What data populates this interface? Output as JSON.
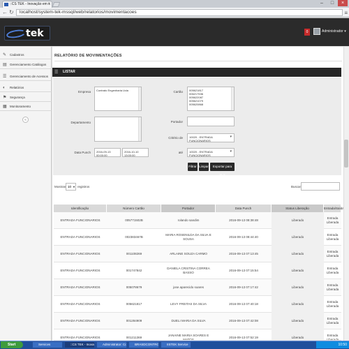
{
  "browser": {
    "tab_title": "::CS TEK - Inovação em s",
    "url": "localhost/system-tek-mssql/web/relatorios/movimentacoes"
  },
  "header": {
    "logo_text": "tek",
    "notification_count": "0",
    "user_name": "Administrador ▾"
  },
  "sidebar": {
    "items": [
      {
        "label": "Cadastros",
        "icon": "✎"
      },
      {
        "label": "Gerenciamento Catálogos",
        "icon": "▤"
      },
      {
        "label": "Gerenciamento de Acessos",
        "icon": "☰"
      },
      {
        "label": "Relatórios",
        "icon": "◐"
      },
      {
        "label": "Segurança",
        "icon": "⚑"
      },
      {
        "label": "Monitoramento",
        "icon": "▦"
      }
    ],
    "collapse_icon": "«"
  },
  "page": {
    "title": "RELATÓRIO DE MOVIMENTAÇÕES",
    "panel_title": "LISTAR"
  },
  "filters": {
    "empresa_label": "Empresa",
    "empresa_value": "Contrato Engenharia Ltda",
    "cartao_label": "Cartão",
    "cartao_values": [
      "005621817",
      "006217536",
      "005622087",
      "005621079",
      "005620868"
    ],
    "departamento_label": "Departamento",
    "portador_label": "Portador",
    "data_label": "Data Punch",
    "data_from": "2016-09-13 00:00:00",
    "data_to": "2016-10-10 13:00:00",
    "criterio_label": "Critério de",
    "criterio_value": "10020 - ENTRADA FUNCIONARIOS",
    "ate_label": "até",
    "ate_value": "10020 - ENTRADA FUNCIONARIOS",
    "btn_filtrar": "Filtrar",
    "btn_limpar": "Limpar",
    "btn_exportar": "Exportar para XLS"
  },
  "listing": {
    "show_label": "Mostrando",
    "show_value": "10",
    "show_after": "registros",
    "search_label": "Buscar:"
  },
  "table": {
    "headers": [
      "Identificação",
      "Número Cartão",
      "Portador",
      "Data Punch",
      "Status Liberação",
      "Entrada/Saída"
    ],
    "rows": [
      {
        "id": "ENTRADA FUNCIONARIOS",
        "card": "005771502B",
        "holder": "rolando sandim",
        "date": "2016-09-13 08:38:48",
        "status": "Liberado",
        "dir": "Entrada Liberada"
      },
      {
        "id": "ENTRADA FUNCIONARIOS",
        "card": "002383467B",
        "holder": "MARIA ROSENILDA DA SILVA E SOUSA",
        "date": "2016-09-13 08:44:40",
        "status": "Liberado",
        "dir": "Entrada Liberada"
      },
      {
        "id": "ENTRADA FUNCIONARIOS",
        "card": "001108269",
        "holder": "ARLAINE SOUZA CARMO",
        "date": "2016-09-13 07:13:45",
        "status": "Liberado",
        "dir": "Entrada Liberada"
      },
      {
        "id": "ENTRADA FUNCIONARIOS",
        "card": "001747842",
        "holder": "DANIELA CRISTINA CORREA BASSO",
        "date": "2016-09-13 07:15:54",
        "status": "Liberado",
        "dir": "Entrada Liberada"
      },
      {
        "id": "ENTRADA FUNCIONARIOS",
        "card": "005078679",
        "holder": "jose aparecido soares",
        "date": "2016-09-13 07:17:42",
        "status": "Liberado",
        "dir": "Entrada Liberada"
      },
      {
        "id": "ENTRADA FUNCIONARIOS",
        "card": "005621817",
        "holder": "LEVY FREITAS DA SILVA",
        "date": "2016-09-13 07:40:18",
        "status": "Liberado",
        "dir": "Entrada Liberada"
      },
      {
        "id": "ENTRADA FUNCIONARIOS",
        "card": "001284909",
        "holder": "DUELI MARIA DA SILVA",
        "date": "2016-09-13 07:42:08",
        "status": "Liberado",
        "dir": "Entrada Liberada"
      },
      {
        "id": "ENTRADA FUNCIONARIOS",
        "card": "001211369",
        "holder": "JANAINE MARIA SOARES E MATOS",
        "date": "2016-09-13 07:52:19",
        "status": "Liberado",
        "dir": "Entrada Liberada"
      }
    ]
  },
  "taskbar": {
    "start": "Start",
    "tasks": [
      "Services",
      "::CS TEK - Inovação em s...",
      "Administrator: Command...",
      "BRASDCONTROL Acesso...",
      "IISTEK Service"
    ],
    "clock": "10:50"
  }
}
